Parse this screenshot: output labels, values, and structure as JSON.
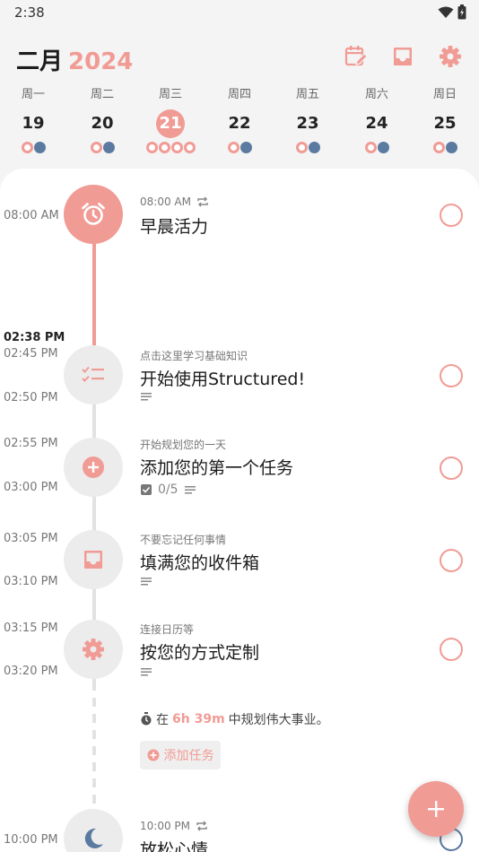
{
  "status": {
    "time": "2:38"
  },
  "header": {
    "month": "二月",
    "year": "2024"
  },
  "colors": {
    "accent": "#f19b95",
    "night": "#5b7aa0",
    "line_gray": "#e2e2e2"
  },
  "week": [
    {
      "dow": "周一",
      "num": "19",
      "dots": [
        "accent-ring",
        "night"
      ]
    },
    {
      "dow": "周二",
      "num": "20",
      "dots": [
        "accent-ring",
        "night"
      ]
    },
    {
      "dow": "周三",
      "num": "21",
      "selected": true,
      "dots": [
        "accent-ring",
        "accent-ring",
        "accent-ring",
        "accent-ring"
      ]
    },
    {
      "dow": "周四",
      "num": "22",
      "dots": [
        "accent-ring",
        "night"
      ]
    },
    {
      "dow": "周五",
      "num": "23",
      "dots": [
        "accent-ring",
        "night"
      ]
    },
    {
      "dow": "周六",
      "num": "24",
      "dots": [
        "accent-ring",
        "night"
      ]
    },
    {
      "dow": "周日",
      "num": "25",
      "dots": [
        "accent-ring",
        "night"
      ]
    }
  ],
  "timeline": {
    "now": "02:38 PM",
    "tasks": [
      {
        "start": "08:00 AM",
        "sub": "08:00 AM",
        "repeat": true,
        "title": "早晨活力",
        "icon": "alarm-icon"
      },
      {
        "start": "02:45 PM",
        "end": "02:50 PM",
        "sub": "点击这里学习基础知识",
        "title": "开始使用Structured!",
        "icon": "checklist-icon",
        "has_notes": true
      },
      {
        "start": "02:55 PM",
        "end": "03:00 PM",
        "sub": "开始规划您的一天",
        "title": "添加您的第一个任务",
        "icon": "plus-circle-icon",
        "subtasks": "0/5",
        "has_notes": true
      },
      {
        "start": "03:05 PM",
        "end": "03:10 PM",
        "sub": "不要忘记任何事情",
        "title": "填满您的收件箱",
        "icon": "inbox-icon",
        "has_notes": true
      },
      {
        "start": "03:15 PM",
        "end": "03:20 PM",
        "sub": "连接日历等",
        "title": "按您的方式定制",
        "icon": "gear-icon",
        "has_notes": true
      },
      {
        "start": "10:00 PM",
        "sub": "10:00 PM",
        "repeat": true,
        "title": "放松心情",
        "icon": "moon-icon"
      }
    ],
    "free_time": {
      "prefix": "在",
      "duration": "6h 39m",
      "suffix": "中规划伟大事业。"
    },
    "add_task_label": "添加任务"
  }
}
